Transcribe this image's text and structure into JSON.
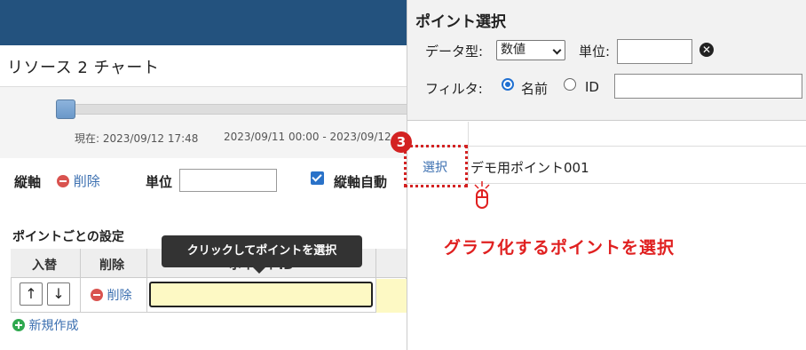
{
  "chart_title": "リソース 2 チャート",
  "slider": {
    "current_label": "現在: 2023/09/12 17:48",
    "range_label": "2023/09/11 00:00 - 2023/09/12"
  },
  "axis": {
    "label": "縦軸",
    "delete": "削除",
    "unit_label": "単位",
    "unit_value": "",
    "auto_label": "縦軸自動"
  },
  "points_section": {
    "title": "ポイントごとの設定",
    "headers": {
      "reorder": "入替",
      "delete": "削除",
      "point_id": "ポイントID"
    },
    "row": {
      "up": "↑",
      "down": "↓",
      "delete": "削除",
      "point_id_value": ""
    },
    "new_create": "新規作成"
  },
  "tooltip": "クリックしてポイントを選択",
  "dialog": {
    "title": "ポイント選択",
    "data_type_label": "データ型:",
    "data_type_value": "数値",
    "unit_label": "単位:",
    "unit_value": "",
    "clear_icon": "✕",
    "filter_label": "フィルタ:",
    "filter_name": "名前",
    "filter_id": "ID",
    "filter_value": "",
    "results": [
      {
        "action": "選択",
        "name": "デモ用ポイント001"
      }
    ]
  },
  "annotation": {
    "step": "3",
    "instruction": "グラフ化するポイントを選択",
    "color": "#e02020"
  },
  "colors": {
    "topbar": "#23527e",
    "link": "#3b6fb0",
    "input_highlight": "#fdf9c4"
  }
}
